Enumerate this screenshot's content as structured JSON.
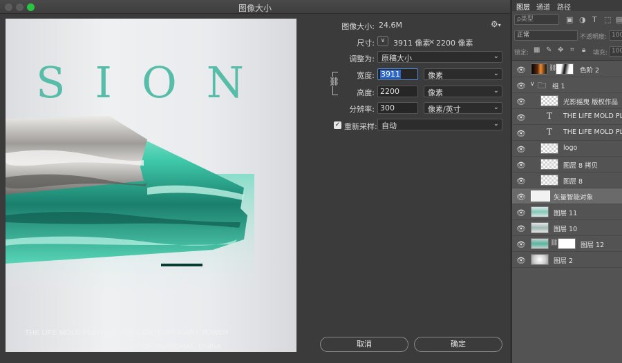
{
  "window": {
    "title": "图像大小"
  },
  "image_size": {
    "label": "图像大小:",
    "value": "24.6M"
  },
  "dimensions": {
    "label": "尺寸:",
    "width": "3911 像素",
    "times": "×",
    "height": "2200 像素"
  },
  "fit_to": {
    "label": "调整为:",
    "value": "原稿大小"
  },
  "width": {
    "label": "宽度:",
    "value": "3911",
    "unit": "像素"
  },
  "height": {
    "label": "高度:",
    "value": "2200",
    "unit": "像素"
  },
  "resolution": {
    "label": "分辨率:",
    "value": "300",
    "unit": "像素/英寸"
  },
  "resample": {
    "label": "重新采样:",
    "checked": true,
    "value": "自动"
  },
  "buttons": {
    "cancel": "取消",
    "ok": "确定"
  },
  "preview": {
    "headline": "SION",
    "caption_line1": "THE LIFE MOLD PLATE OF THE CONTEMPORARY TOWER",
    "caption_line2": "TIP OF SHANGHAI - CHINA"
  },
  "layers_panel": {
    "tabs": [
      "图层",
      "通道",
      "路径"
    ],
    "filter_kind": "ρ类型",
    "blend_mode": "正常",
    "opacity_label": "不透明度:",
    "opacity_value": "100",
    "lock_label": "锁定:",
    "fill_label": "填充:",
    "fill_value": "100",
    "layers": [
      {
        "name": "色阶 2",
        "type": "adjustment"
      },
      {
        "name": "组 1",
        "type": "group"
      },
      {
        "name": "光影摇曳 版权作品",
        "type": "pixel"
      },
      {
        "name": "THE LIFE MOLD PLA",
        "type": "text"
      },
      {
        "name": "THE LIFE MOLD PLA",
        "type": "text"
      },
      {
        "name": "logo",
        "type": "pixel"
      },
      {
        "name": "图层 8 拷贝",
        "type": "pixel"
      },
      {
        "name": "图层 8",
        "type": "pixel"
      },
      {
        "name": "矢量智能对象",
        "type": "smart-object"
      },
      {
        "name": "图层 11",
        "type": "pixel"
      },
      {
        "name": "图层 10",
        "type": "pixel"
      },
      {
        "name": "图层 12",
        "type": "masked"
      },
      {
        "name": "图层 2",
        "type": "pixel"
      }
    ]
  },
  "colors": {
    "accent_teal": "#58bda8",
    "selection_blue": "#2f67c9",
    "zoom_green": "#29c443"
  }
}
